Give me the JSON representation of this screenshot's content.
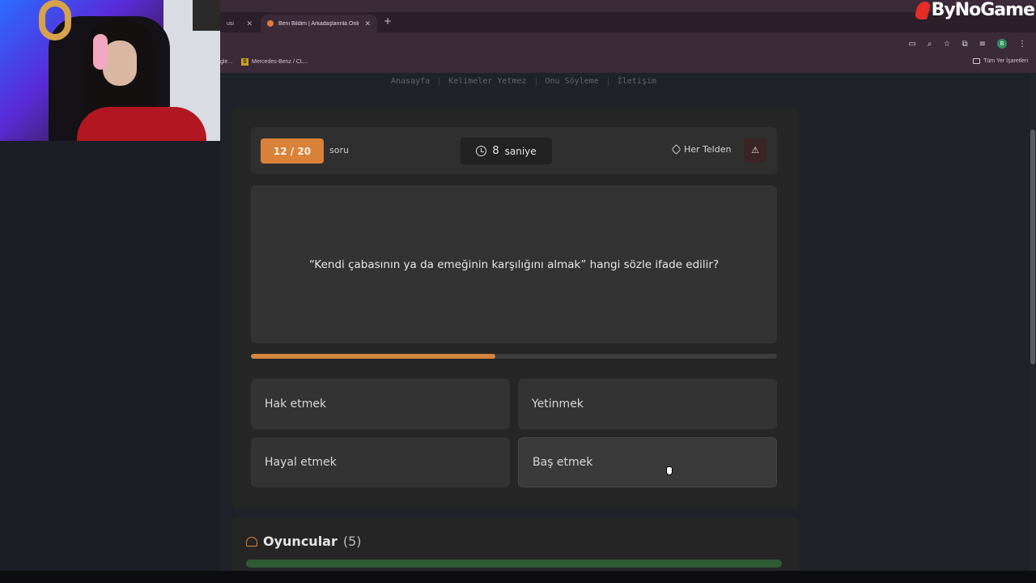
{
  "overlay": {
    "brand": "ByNoGame"
  },
  "browser": {
    "tabs": [
      {
        "label": "usi",
        "active": false
      },
      {
        "label": "Beni Bildim | Arkadaşlarınla Onli",
        "active": true
      }
    ],
    "new_tab": "+",
    "bookmarks": [
      "gle...",
      "Mercedes-Benz / CL...",
      "Tüm Yer İşaretleri"
    ]
  },
  "nav": {
    "links": [
      "Anasayfa",
      "Kelimeler Yetmez",
      "Onu Söyleme",
      "İletişim"
    ]
  },
  "quiz": {
    "counter": "12 / 20",
    "counter_suffix": "soru",
    "timer_value": "8",
    "timer_unit": "saniye",
    "category": "Her Telden",
    "report_icon": "⚠",
    "question": "“Kendi çabasının ya da emeğinin karşılığını almak” hangi sözle ifade edilir?",
    "progress": 0.465,
    "answers": [
      "Hak etmek",
      "Yetinmek",
      "Hayal etmek",
      "Baş etmek"
    ]
  },
  "players": {
    "title": "Oyuncular",
    "count": "(5)"
  },
  "colors": {
    "accent": "#d9823a",
    "card": "#262626",
    "page": "#1f2229"
  }
}
